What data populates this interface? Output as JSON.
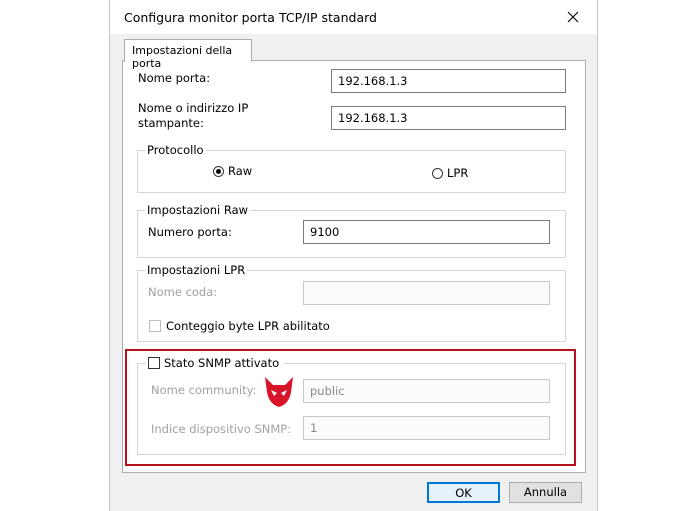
{
  "window": {
    "title": "Configura monitor porta TCP/IP standard",
    "close_icon": "close-icon"
  },
  "tab": {
    "label": "Impostazioni della porta"
  },
  "port_name": {
    "label": "Nome porta:",
    "value": "192.168.1.3"
  },
  "printer_ip": {
    "label_line1": "Nome o indirizzo IP",
    "label_line2": "stampante:",
    "value": "192.168.1.3"
  },
  "protocol": {
    "legend": "Protocollo",
    "options": [
      "Raw",
      "LPR"
    ],
    "selected": "Raw"
  },
  "raw_settings": {
    "legend": "Impostazioni Raw",
    "port_number_label": "Numero porta:",
    "port_number_value": "9100"
  },
  "lpr_settings": {
    "legend": "Impostazioni LPR",
    "queue_name_label": "Nome coda:",
    "queue_name_value": "",
    "byte_count_label": "Conteggio byte LPR abilitato",
    "byte_count_checked": false
  },
  "snmp": {
    "enabled_label": "Stato SNMP attivato",
    "enabled": false,
    "community_label": "Nome community:",
    "community_value": "public",
    "device_index_label": "Indice dispositivo SNMP:",
    "device_index_value": "1"
  },
  "buttons": {
    "ok": "OK",
    "cancel": "Annulla"
  },
  "colors": {
    "highlight": "#b3121f",
    "ok_border": "#0078d7",
    "logo": "#d7142a"
  }
}
